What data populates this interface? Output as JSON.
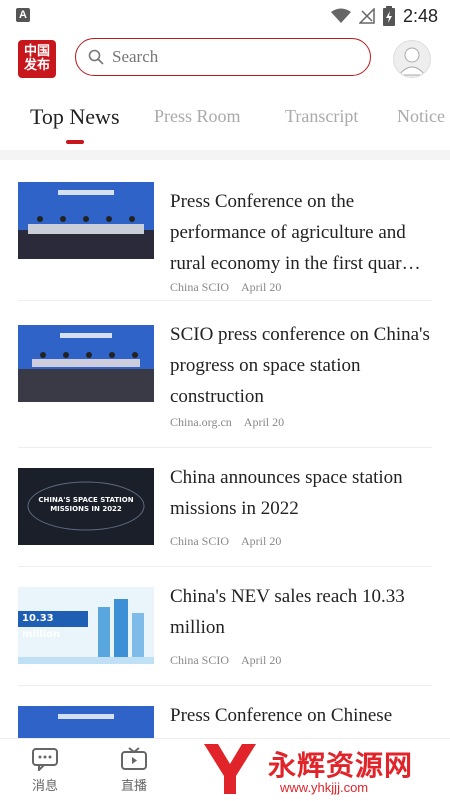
{
  "status": {
    "time": "2:48",
    "app_badge": "A"
  },
  "search": {
    "placeholder": "Search"
  },
  "logo": {
    "line1": "中国",
    "line2": "发布"
  },
  "tabs": [
    {
      "label": "Top News"
    },
    {
      "label": "Press Room"
    },
    {
      "label": "Transcript"
    },
    {
      "label": "Notice"
    }
  ],
  "articles": [
    {
      "title": "Press Conference on the performance of agriculture and rural economy in the first quar…",
      "source": "China SCIO",
      "date": "April 20",
      "thumb": "press-conference-blue"
    },
    {
      "title": "SCIO press conference on China's progress on space station construction",
      "source": "China.org.cn",
      "date": "April 20",
      "thumb": "press-conference-hall"
    },
    {
      "title": "China announces space station missions in 2022",
      "source": "China SCIO",
      "date": "April 20",
      "thumb": "space-station-graphic",
      "thumb_text": "CHINA'S SPACE STATION MISSIONS IN 2022"
    },
    {
      "title": "China's NEV sales reach 10.33 million",
      "source": "China SCIO",
      "date": "April 20",
      "thumb": "nev-sales-graphic",
      "thumb_text": "10.33 million"
    },
    {
      "title": "Press Conference on Chinese",
      "source": "",
      "date": "",
      "thumb": "press-conference-blue"
    }
  ],
  "bottom_nav": [
    {
      "label": "消息",
      "icon": "message-icon"
    },
    {
      "label": "直播",
      "icon": "tv-icon"
    }
  ],
  "watermark": {
    "text": "永辉资源网",
    "url": "www.yhkjjj.com"
  },
  "colors": {
    "accent": "#c8161d",
    "text": "#222222",
    "muted": "#888888"
  }
}
